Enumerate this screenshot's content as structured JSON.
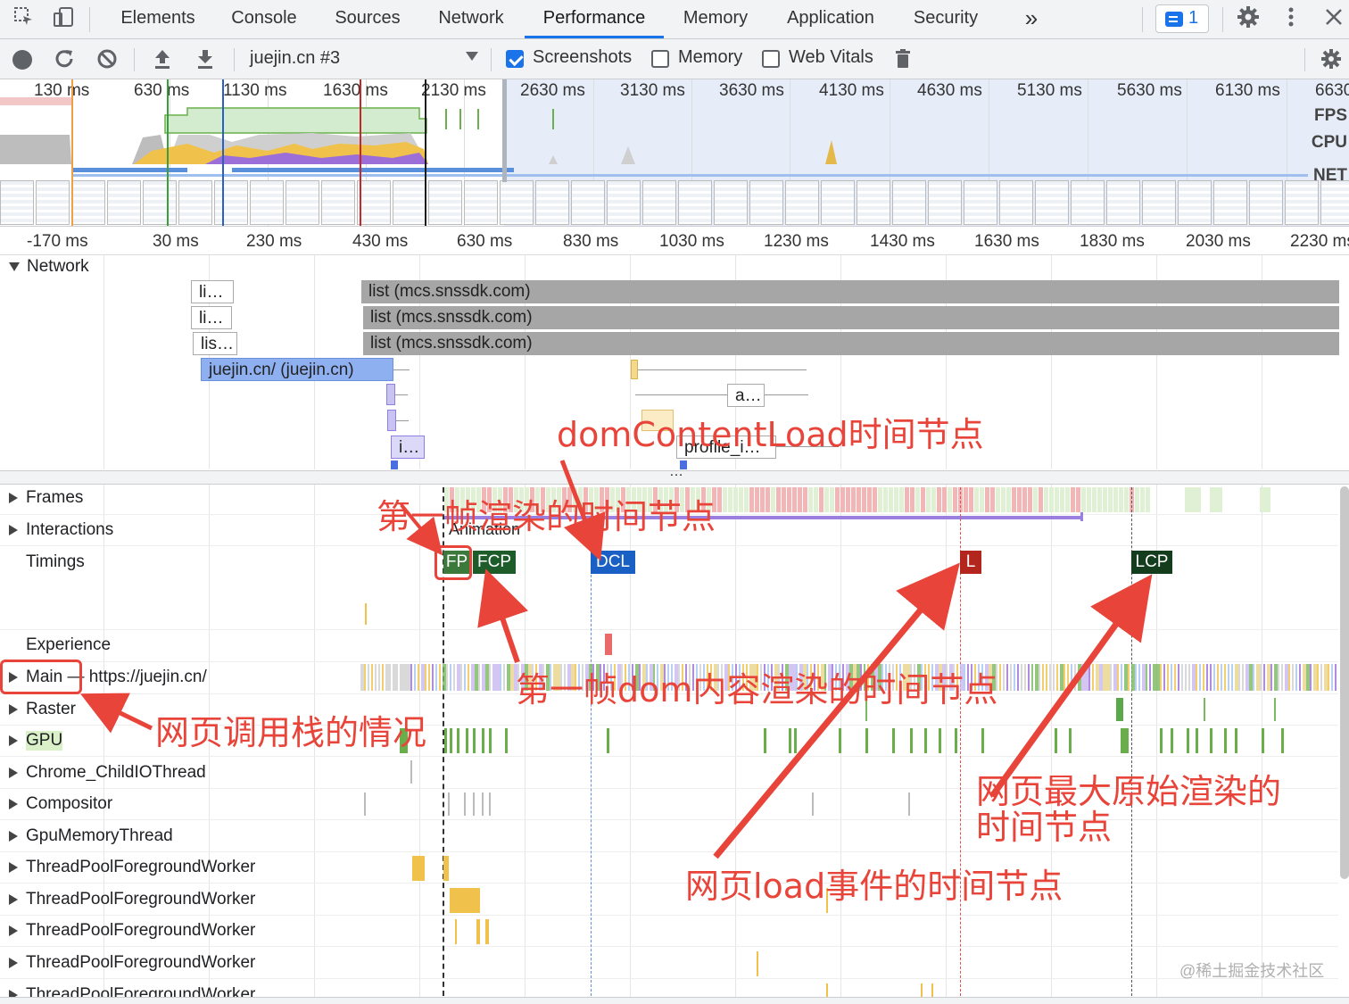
{
  "toolbar": {
    "tabs": [
      "Elements",
      "Console",
      "Sources",
      "Network",
      "Performance",
      "Memory",
      "Application",
      "Security"
    ],
    "active_tab": "Performance",
    "more_tabs_glyph": "»",
    "issues_count": "1",
    "icons": [
      "inspect-element-icon",
      "device-toolbar-icon",
      "settings-gear-icon",
      "more-vertical-icon",
      "close-icon"
    ]
  },
  "controls": {
    "profile_label": "juejin.cn #3",
    "screenshots_label": "Screenshots",
    "screenshots_checked": true,
    "memory_label": "Memory",
    "memory_checked": false,
    "webvitals_label": "Web Vitals",
    "webvitals_checked": false,
    "icons": [
      "record-icon",
      "reload-icon",
      "clear-icon",
      "upload-icon",
      "download-icon",
      "trash-icon",
      "capture-settings-icon"
    ]
  },
  "overview": {
    "ticks": [
      "130 ms",
      "630 ms",
      "1130 ms",
      "1630 ms",
      "2130 ms",
      "2630 ms",
      "3130 ms",
      "3630 ms",
      "4130 ms",
      "4630 ms",
      "5130 ms",
      "5630 ms",
      "6130 ms",
      "6630"
    ],
    "labels": [
      "FPS",
      "CPU",
      "NET"
    ]
  },
  "ruler": {
    "ticks": [
      "-170 ms",
      "30 ms",
      "230 ms",
      "430 ms",
      "630 ms",
      "830 ms",
      "1030 ms",
      "1230 ms",
      "1430 ms",
      "1630 ms",
      "1830 ms",
      "2030 ms",
      "2230 ms"
    ]
  },
  "network": {
    "title": "Network",
    "requests": [
      {
        "label": "li…"
      },
      {
        "label": "li…"
      },
      {
        "label": "lis…"
      },
      {
        "label": "list (mcs.snssdk.com)"
      },
      {
        "label": "list (mcs.snssdk.com)"
      },
      {
        "label": "list (mcs.snssdk.com)"
      },
      {
        "label": "juejin.cn/ (juejin.cn)"
      },
      {
        "label": "a…"
      },
      {
        "label": "i…"
      },
      {
        "label": "profile_i…"
      },
      {
        "label": "…"
      }
    ]
  },
  "tracks": {
    "frames": "Frames",
    "interactions": "Interactions",
    "animation": "Animation",
    "timings": "Timings",
    "experience": "Experience",
    "main": "Main — https://juejin.cn/",
    "raster": "Raster",
    "gpu": "GPU",
    "io": "Chrome_ChildIOThread",
    "compositor": "Compositor",
    "gpumem": "GpuMemoryThread",
    "workers": [
      "ThreadPoolForegroundWorker",
      "ThreadPoolForegroundWorker",
      "ThreadPoolForegroundWorker",
      "ThreadPoolForegroundWorker",
      "ThreadPoolForegroundWorker"
    ]
  },
  "timings": {
    "fp": "FP",
    "fcp": "FCP",
    "dcl": "DCL",
    "l": "L",
    "lcp": "LCP",
    "colors": {
      "fp": "#3b7a3b",
      "fcp": "#1e5c2a",
      "dcl": "#1a5fc4",
      "l": "#b3261e",
      "lcp": "#133d1c"
    }
  },
  "annotations": {
    "dcl": "domContentLoad时间节点",
    "fp": "第一帧渲染的时间节点",
    "fcp": "第一帧dom内容渲染的时间节点",
    "main": "网页调用栈的情况",
    "lcp_line1": "网页最大原始渲染的",
    "lcp_line2": "时间节点",
    "load": "网页load事件的时间节点",
    "color": "#e8443a"
  },
  "watermark": "@稀土掘金技术社区"
}
